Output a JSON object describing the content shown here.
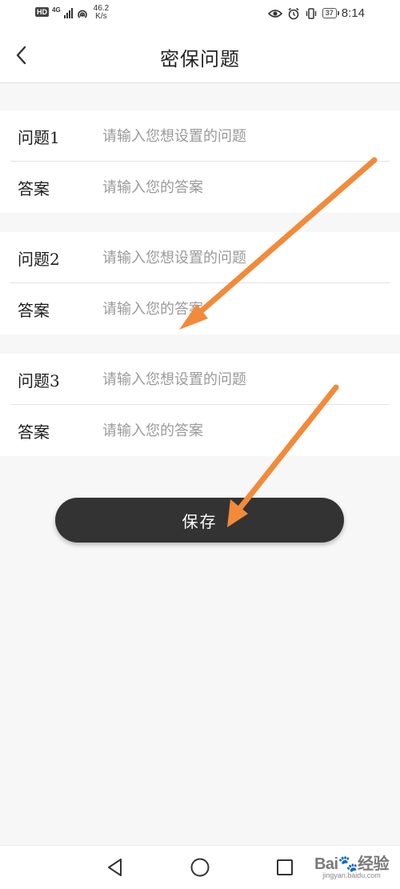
{
  "status_bar": {
    "hd": "HD",
    "network": "4G",
    "speed": "46.2",
    "speed_unit": "K/s",
    "battery": "37",
    "time": "8:14"
  },
  "header": {
    "title": "密保问题"
  },
  "groups": [
    {
      "question_label": "问题1",
      "question_placeholder": "请输入您想设置的问题",
      "answer_label": "答案",
      "answer_placeholder": "请输入您的答案"
    },
    {
      "question_label": "问题2",
      "question_placeholder": "请输入您想设置的问题",
      "answer_label": "答案",
      "answer_placeholder": "请输入您的答案"
    },
    {
      "question_label": "问题3",
      "question_placeholder": "请输入您想设置的问题",
      "answer_label": "答案",
      "answer_placeholder": "请输入您的答案"
    }
  ],
  "save_label": "保存",
  "watermark": {
    "brand": "Bai",
    "brand_suffix": "经验",
    "site": "jingyan.baidu.com"
  },
  "colors": {
    "accent_arrow": "#f28a3a",
    "button_bg": "#333333"
  }
}
